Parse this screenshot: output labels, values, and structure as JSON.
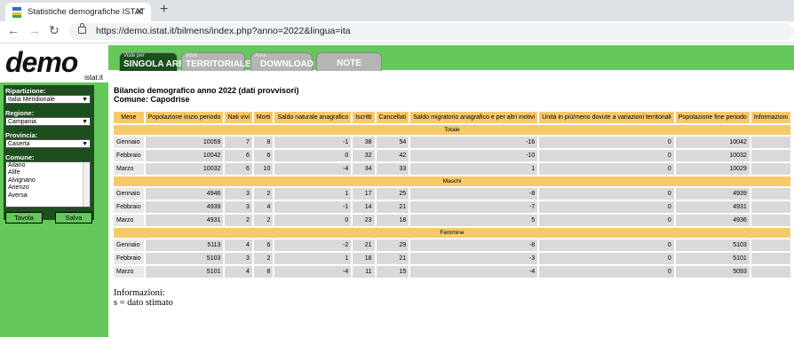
{
  "browser": {
    "tab_title": "Statistiche demografiche ISTAT",
    "new_tab": "+",
    "url": "https://demo.istat.it/bilmens/index.php?anno=2022&lingua=ita"
  },
  "logo": {
    "text": "demo",
    "sub": "istat.it"
  },
  "nav_tabs": [
    {
      "small": "Viste per",
      "label": "SINGOLA AREA"
    },
    {
      "small": "Viste",
      "label": "TERRITORIALE"
    },
    {
      "small": "Area",
      "label": "DOWNLOAD"
    },
    {
      "small": "",
      "label": "NOTE"
    }
  ],
  "sidebar": {
    "ripartizione_label": "Ripartizione:",
    "ripartizione_value": "Italia Meridionale",
    "regione_label": "Regione:",
    "regione_value": "Campania",
    "provincia_label": "Provincia:",
    "provincia_value": "Caserta",
    "comune_label": "Comune:",
    "comuni": [
      "Ailano",
      "Alife",
      "Alvignano",
      "Arienzo",
      "Aversa"
    ],
    "btn_tavola": "Tavola",
    "btn_salva": "Salva"
  },
  "content": {
    "title": "Bilancio demografico anno 2022 (dati provvisori)",
    "subtitle": "Comune: Capodrise",
    "headers": [
      "Mese",
      "Popolazione inizio periodo",
      "Nati vivi",
      "Morti",
      "Saldo naturale anagrafico",
      "Iscritti",
      "Cancellati",
      "Saldo migratorio anagrafico e per altri motivi",
      "Unità in più/meno dovute a variazioni territoriali",
      "Popolazione fine periodo",
      "Informazioni"
    ],
    "sections": [
      {
        "name": "Totale",
        "rows": [
          [
            "Gennaio",
            "10059",
            "7",
            "8",
            "-1",
            "38",
            "54",
            "-16",
            "0",
            "10042",
            ""
          ],
          [
            "Febbraio",
            "10042",
            "6",
            "6",
            "0",
            "32",
            "42",
            "-10",
            "0",
            "10032",
            ""
          ],
          [
            "Marzo",
            "10032",
            "6",
            "10",
            "-4",
            "34",
            "33",
            "1",
            "0",
            "10029",
            ""
          ]
        ]
      },
      {
        "name": "Maschi",
        "rows": [
          [
            "Gennaio",
            "4946",
            "3",
            "2",
            "1",
            "17",
            "25",
            "-8",
            "0",
            "4939",
            ""
          ],
          [
            "Febbraio",
            "4939",
            "3",
            "4",
            "-1",
            "14",
            "21",
            "-7",
            "0",
            "4931",
            ""
          ],
          [
            "Marzo",
            "4931",
            "2",
            "2",
            "0",
            "23",
            "18",
            "5",
            "0",
            "4936",
            ""
          ]
        ]
      },
      {
        "name": "Femmine",
        "rows": [
          [
            "Gennaio",
            "5113",
            "4",
            "6",
            "-2",
            "21",
            "29",
            "-8",
            "0",
            "5103",
            ""
          ],
          [
            "Febbraio",
            "5103",
            "3",
            "2",
            "1",
            "18",
            "21",
            "-3",
            "0",
            "5101",
            ""
          ],
          [
            "Marzo",
            "5101",
            "4",
            "8",
            "-4",
            "11",
            "15",
            "-4",
            "0",
            "5093",
            ""
          ]
        ]
      }
    ],
    "info_title": "Informazioni:",
    "info_note": "s = dato stimato"
  }
}
